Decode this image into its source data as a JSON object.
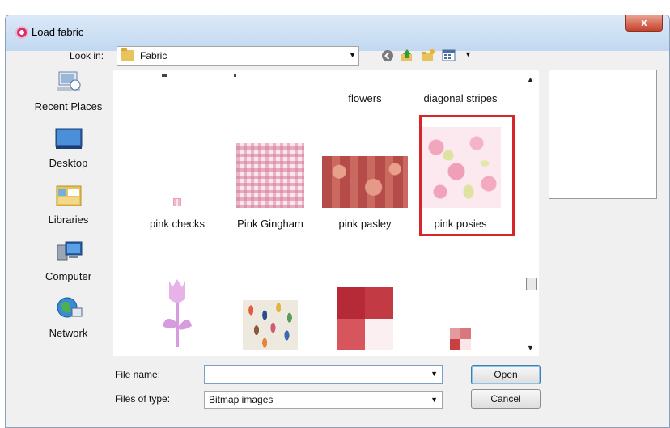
{
  "window": {
    "title": "Load fabric",
    "close_glyph": "x"
  },
  "lookin": {
    "label": "Look in:",
    "value": "Fabric"
  },
  "toolbar": {
    "icons": [
      "back-icon",
      "up-folder-icon",
      "new-folder-icon",
      "view-menu-icon"
    ]
  },
  "places": [
    {
      "label": "Recent Places",
      "icon": "recent-places-icon"
    },
    {
      "label": "Desktop",
      "icon": "desktop-icon"
    },
    {
      "label": "Libraries",
      "icon": "libraries-icon"
    },
    {
      "label": "Computer",
      "icon": "computer-icon"
    },
    {
      "label": "Network",
      "icon": "network-icon"
    }
  ],
  "files": {
    "top_row_labels": [
      "flowers",
      "diagonal stripes"
    ],
    "row1": [
      "pink checks",
      "Pink Gingham",
      "pink pasley",
      "pink posies"
    ],
    "selected": "pink posies"
  },
  "form": {
    "file_name_label": "File name:",
    "file_name_value": "",
    "file_type_label": "Files of type:",
    "file_type_value": "Bitmap images",
    "open_label": "Open",
    "cancel_label": "Cancel"
  },
  "colors": {
    "selection": "#d6262a",
    "title_bar": "#c2d8f0",
    "close_button": "#c7412b"
  }
}
